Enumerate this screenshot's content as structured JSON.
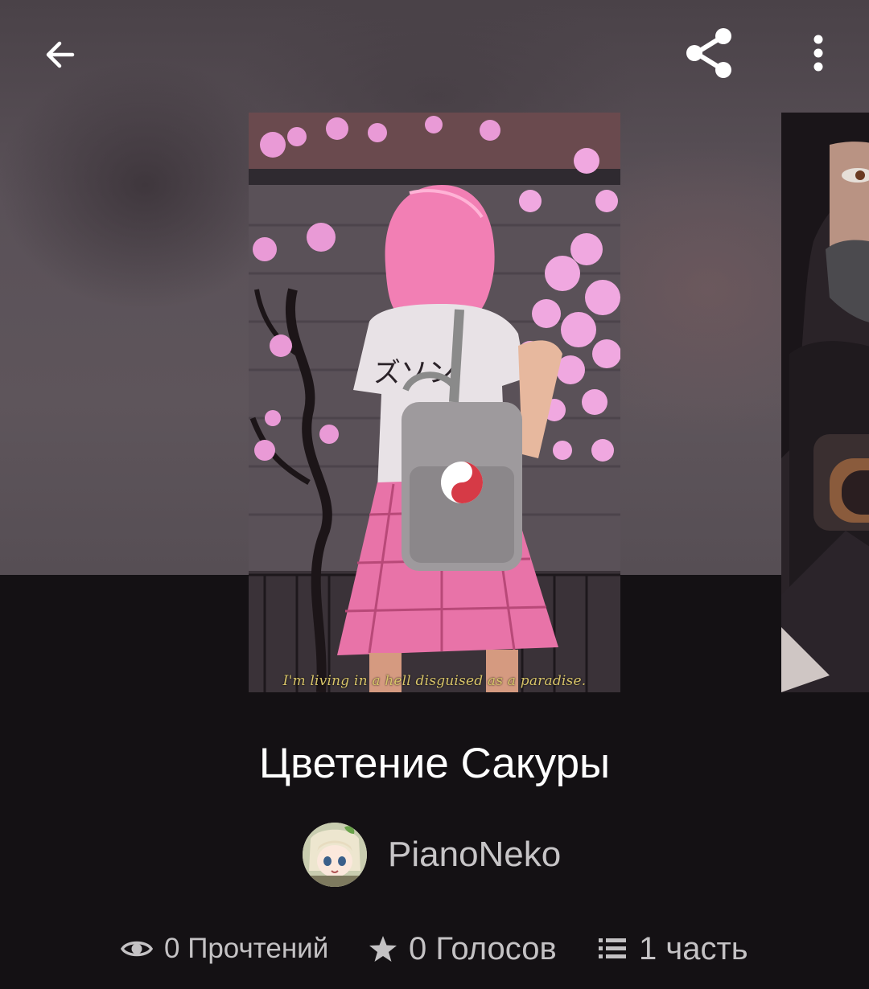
{
  "header": {
    "back_icon": "arrow-left-icon",
    "share_icon": "share-icon",
    "more_icon": "more-vertical-icon"
  },
  "story": {
    "cover_caption": "I'm living in a hell disguised as a paradise.",
    "title": "Цветение Сакуры",
    "author": "PianoNeko"
  },
  "stats": {
    "reads": "0 Прочтений",
    "votes": "0 Голосов",
    "parts": "1 часть"
  },
  "colors": {
    "background": "#141114",
    "hero_bg": "#5a5158",
    "title": "#ffffff",
    "muted_text": "#c4c2c4"
  }
}
